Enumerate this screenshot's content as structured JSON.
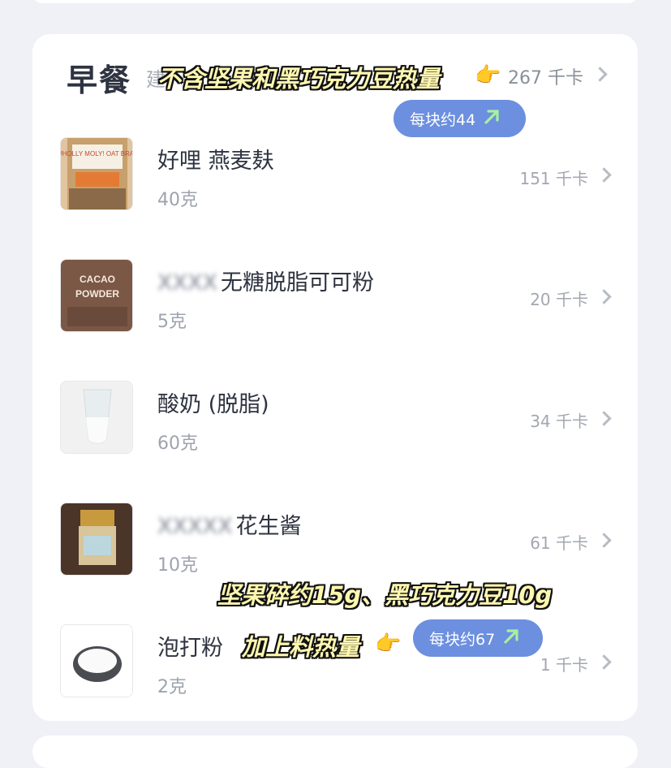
{
  "meal": {
    "title": "早餐",
    "title_sub": "建",
    "total_kcal": "267 千卡"
  },
  "annotations": {
    "top": "不含坚果和黑巧克力豆热量",
    "pill_top": "每块约44",
    "middle": "坚果碎约15g、黑巧克力豆10g",
    "bottom": "加上料热量",
    "pill_bottom": "每块约67"
  },
  "foods": [
    {
      "name": "好哩 燕麦麸",
      "amount": "40克",
      "kcal": "151 千卡",
      "thumb_label": "WHOLLY MOLY! OAT BRAN"
    },
    {
      "name_blurred": "XXXX",
      "name": "无糖脱脂可可粉",
      "amount": "5克",
      "kcal": "20 千卡",
      "thumb_label": "ORGANIC CACAO POWDER"
    },
    {
      "name": "酸奶 (脱脂)",
      "amount": "60克",
      "kcal": "34 千卡"
    },
    {
      "name_blurred": "XXXXX",
      "name": "花生酱",
      "amount": "10克",
      "kcal": "61 千卡"
    },
    {
      "name": "泡打粉",
      "amount": "2克",
      "kcal": "1 千卡"
    }
  ],
  "colors": {
    "pill": "#6c8fdf",
    "pill_arrow": "#a8f0a0",
    "overlay_text": "#fff7b0"
  },
  "icons": [
    "chevron-right-icon",
    "pointing-hand-icon",
    "arrow-up-right-icon"
  ]
}
